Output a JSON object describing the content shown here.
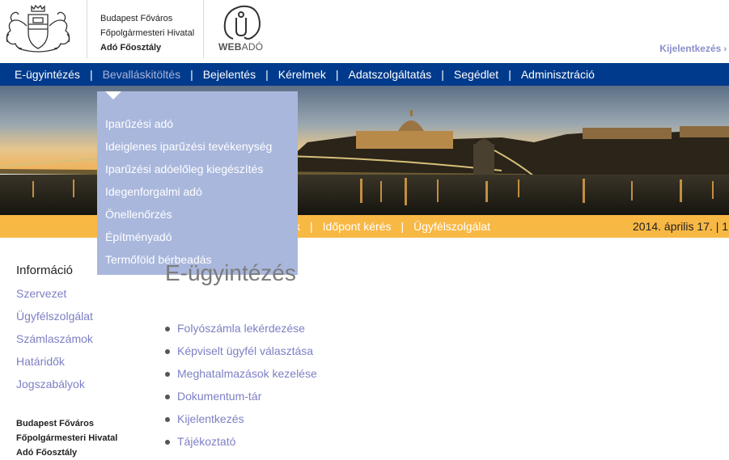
{
  "header": {
    "org_line1": "Budapest Főváros",
    "org_line2": "Főpolgármesteri Hivatal",
    "org_line3": "Adó Főosztály",
    "logo_text_bold": "WEB",
    "logo_text_light": "ADÓ",
    "logout_label": "Kijelentkezés",
    "logout_icon": "chevron-right-icon"
  },
  "nav": {
    "items": [
      {
        "label": "E-ügyintézés"
      },
      {
        "label": "Bevalláskitöltés"
      },
      {
        "label": "Bejelentés"
      },
      {
        "label": "Kérelmek"
      },
      {
        "label": "Adatszolgáltatás"
      },
      {
        "label": "Segédlet"
      },
      {
        "label": "Adminisztráció"
      }
    ],
    "separator": "|"
  },
  "dropdown": {
    "items": [
      {
        "label": "Iparűzési adó"
      },
      {
        "label": "Ideiglenes iparűzési tevékenység"
      },
      {
        "label": "Iparűzési adóelőleg kiegészítés"
      },
      {
        "label": "Idegenforgalmi adó"
      },
      {
        "label": "Önellenőrzés"
      },
      {
        "label": "Építményadó"
      },
      {
        "label": "Termőföld bérbeadás"
      }
    ]
  },
  "subbar": {
    "partial_label": "k",
    "link1": "Időpont kérés",
    "link2": "Ügyfélszolgálat",
    "separator": "|",
    "date": "2014. április 17. | 1"
  },
  "sidebar": {
    "title": "Információ",
    "items": [
      {
        "label": "Szervezet"
      },
      {
        "label": "Ügyfélszolgálat"
      },
      {
        "label": "Számlaszámok"
      },
      {
        "label": "Határidők"
      },
      {
        "label": "Jogszabályok"
      }
    ],
    "footer_line1": "Budapest Főváros",
    "footer_line2": "Főpolgármesteri Hivatal",
    "footer_line3": "Adó Főosztály"
  },
  "main": {
    "title": "E-ügyintézés",
    "links": [
      {
        "label": "Folyószámla lekérdezése"
      },
      {
        "label": "Képviselt ügyfél választása"
      },
      {
        "label": "Meghatalmazások kezelése"
      },
      {
        "label": "Dokumentum-tár"
      },
      {
        "label": "Kijelentkezés"
      },
      {
        "label": "Tájékoztató"
      }
    ]
  },
  "colors": {
    "nav_bg": "#003a8c",
    "dropdown_bg": "#a9b7dc",
    "subbar_bg": "#f8b844",
    "link": "#7d7fc4"
  }
}
